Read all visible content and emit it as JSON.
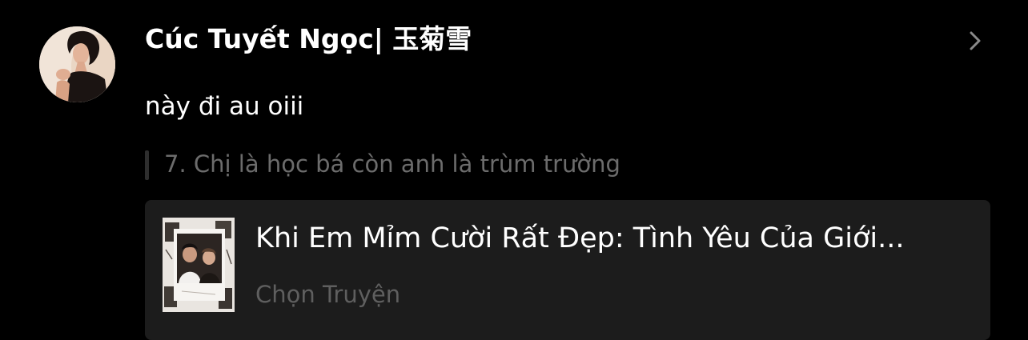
{
  "comment": {
    "author": {
      "name": "Cúc Tuyết Ngọc| 玉菊雪",
      "avatar": "user-avatar-photo"
    },
    "text": "này đi au oiii",
    "quoted_chapter": "7. Chị là học bá còn anh là trùm trường",
    "chevron_icon": "chevron-right-icon"
  },
  "story_card": {
    "title": "Khi Em Mỉm Cười Rất Đẹp: Tình Yêu Của Giới...",
    "action_label": "Chọn Truyện",
    "cover": "story-cover-image"
  },
  "colors": {
    "background": "#000000",
    "card": "#1c1c1c",
    "primary_text": "#ffffff",
    "muted_text": "#6c6c6c"
  }
}
